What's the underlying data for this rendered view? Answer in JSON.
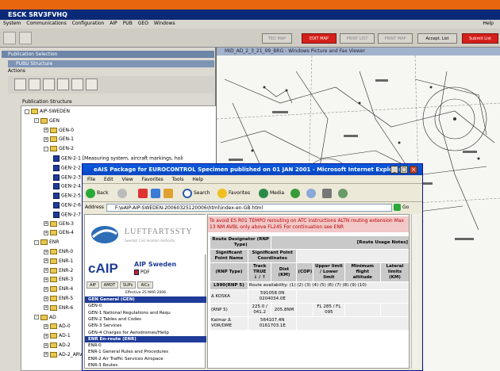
{
  "app": {
    "title": "ESCK SRV3FVHQ"
  },
  "menubar": {
    "items": [
      "System",
      "Communications",
      "Configuration",
      "AIP",
      "PUB",
      "GEO",
      "Windows"
    ],
    "help": "Help"
  },
  "toolbar": {
    "buttons": [
      {
        "label": "TED MAP",
        "style": "disabled"
      },
      {
        "label": "EDIT MAP",
        "style": "red"
      },
      {
        "label": "PRINT LIST",
        "style": "disabled"
      },
      {
        "label": "PRINT MAP",
        "style": "disabled"
      },
      {
        "label": "Accept. List",
        "style": "active"
      },
      {
        "label": "Submit List",
        "style": "red"
      }
    ]
  },
  "left_panel": {
    "title": "Publication Selection",
    "subtitle": "PUBU Structure",
    "actions_label": "Actions",
    "structure_label": "Publication Structure",
    "tree": [
      {
        "label": "AIP-SWEDEN",
        "type": "folder",
        "level": 0
      },
      {
        "label": "GEN",
        "type": "folder",
        "level": 1
      },
      {
        "label": "GEN-0",
        "type": "folder",
        "level": 2
      },
      {
        "label": "GEN-1",
        "type": "folder",
        "level": 2
      },
      {
        "label": "GEN-2",
        "type": "folder",
        "level": 2
      },
      {
        "label": "GEN-2-1 [Measuring system, aircraft markings, holi",
        "type": "doc",
        "level": 3
      },
      {
        "label": "GEN-2-2 [Abbreviations]",
        "type": "doc",
        "level": 3
      },
      {
        "label": "GEN-2-3",
        "type": "doc",
        "level": 3
      },
      {
        "label": "GEN-2-4",
        "type": "doc",
        "level": 3
      },
      {
        "label": "GEN-2-5",
        "type": "doc",
        "level": 3
      },
      {
        "label": "GEN-2-6",
        "type": "doc",
        "level": 3
      },
      {
        "label": "GEN-2-7",
        "type": "doc",
        "level": 3
      },
      {
        "label": "GEN-3",
        "type": "folder",
        "level": 2
      },
      {
        "label": "GEN-4",
        "type": "folder",
        "level": 2
      },
      {
        "label": "ENR",
        "type": "folder",
        "level": 1
      },
      {
        "label": "ENR-0",
        "type": "folder",
        "level": 2
      },
      {
        "label": "ENR-1",
        "type": "folder",
        "level": 2
      },
      {
        "label": "ENR-2",
        "type": "folder",
        "level": 2
      },
      {
        "label": "ENR-3",
        "type": "folder",
        "level": 2
      },
      {
        "label": "ENR-4",
        "type": "folder",
        "level": 2
      },
      {
        "label": "ENR-5",
        "type": "folder",
        "level": 2
      },
      {
        "label": "ENR-6",
        "type": "folder",
        "level": 2
      },
      {
        "label": "AD",
        "type": "folder",
        "level": 1
      },
      {
        "label": "AD-0",
        "type": "folder",
        "level": 2
      },
      {
        "label": "AD-1",
        "type": "folder",
        "level": 2
      },
      {
        "label": "AD-2",
        "type": "folder",
        "level": 2
      },
      {
        "label": "AD-2_ARV",
        "type": "folder",
        "level": 2
      }
    ]
  },
  "map_window": {
    "title": "MID_AD_2_3_21_99_BRG - Windows Picture and Fax Viewer"
  },
  "ie_window": {
    "title": "eAIS Package for EUROCONTROL Specimen published on 01 JAN 2001 - Microsoft Internet Explorer",
    "menu": [
      "File",
      "Edit",
      "View",
      "Favorites",
      "Tools",
      "Help"
    ],
    "tools": {
      "back": "Back",
      "search": "Search",
      "favorites": "Favorites",
      "media": "Media"
    },
    "address_label": "Address",
    "address": "F:\\eAIP-AIP-SWEDEN-20060325120006\\html\\index-en-GB.html",
    "go": "Go",
    "nav": {
      "org": "LUFTFARTSSTY",
      "org_sub": "Swedish Civil Aviation Authority",
      "caip": "cAIP",
      "caip_title": "AIP Sweden",
      "pdf": "PDF",
      "tabs": [
        "AIP",
        "AMDT",
        "SUPs",
        "AICs"
      ],
      "effective": "Effective 25 MAR 2006",
      "items": [
        {
          "label": "GEN General (GEN)",
          "hl": true
        },
        {
          "label": "GEN-0",
          "hl": false
        },
        {
          "label": "GEN-1 National Regulations and Requ",
          "hl": false
        },
        {
          "label": "GEN-2 Tables and Codes",
          "hl": false
        },
        {
          "label": "GEN-3 Services",
          "hl": false
        },
        {
          "label": "GEN-4 Charges for Aerodromes/Helip",
          "hl": false
        },
        {
          "label": "ENR En-route (ENR)",
          "hl": true
        },
        {
          "label": "ENR-0",
          "hl": false
        },
        {
          "label": "ENR-1 General Rules and Procedures",
          "hl": false
        },
        {
          "label": "ENR-2 Air Traffic Services Airspace",
          "hl": false
        },
        {
          "label": "ENR-3 Routes",
          "hl": false
        }
      ]
    },
    "content": {
      "warning": "To avoid ES R01 TEMPO rerouting on ATC instructions ALTN routing extension Max 13 NM AVBL only above FL245 For continuation see ENR",
      "hdr_route": "Route Designator (RNP Type)",
      "hdr_usage": "[Route Usage Notes]",
      "hdr_sig": "Significant Point Name",
      "hdr_coord": "Significant Point Coordinates",
      "hdr_rnp": "(RNP Type)",
      "hdr_track": "Track TRUE",
      "hdr_track_arrows": "↓ / ↑",
      "hdr_dist": "Dist (KM)",
      "hdr_cop": "(COP)",
      "hdr_limits": "Upper limit / Lower limit",
      "hdr_min": "Minimum flight altitude",
      "hdr_lateral": "Lateral limits (KM)",
      "route_row": {
        "designator": "L990(RNP 5)",
        "availability": "Route availability: (1) (2) (3) (4) (5) (6) (7) (8) (9) (10)"
      },
      "rows": [
        {
          "name": "Δ KOSKA",
          "coord": "591058.0N 0204034.0E",
          "track": "",
          "dist": "",
          "limits": ""
        },
        {
          "name": "(RNP 5)",
          "coord": "",
          "track": "225.0 / 041.2",
          "dist": "205.8NM",
          "limits": "FL 285 / FL 095"
        },
        {
          "name": "Kalmar Δ VOR/DME",
          "coord": "564107.4N 0161703.1E",
          "track": "",
          "dist": "",
          "limits": ""
        }
      ]
    }
  }
}
